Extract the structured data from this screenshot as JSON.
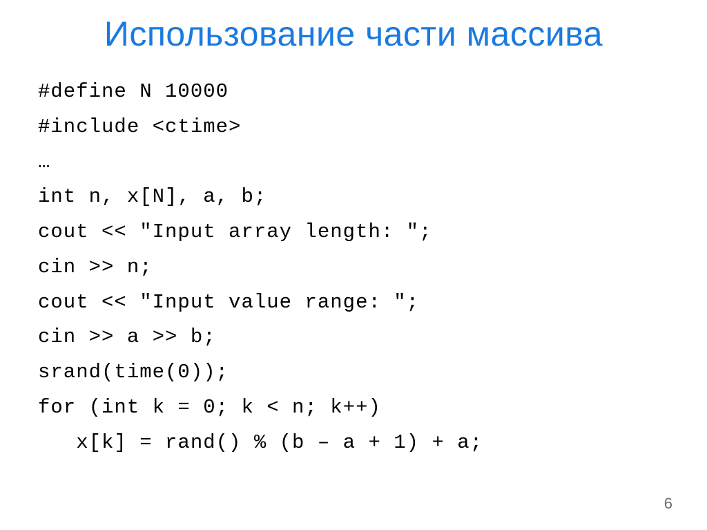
{
  "slide": {
    "title": "Использование части массива",
    "code": {
      "line1": "#define N 10000",
      "line2": "#include <ctime>",
      "line3": "…",
      "line4": "int n, x[N], a, b;",
      "line5": "cout << \"Input array length: \";",
      "line6": "cin >> n;",
      "line7": "cout << \"Input value range: \";",
      "line8": "cin >> a >> b;",
      "line9": "srand(time(0));",
      "line10": "for (int k = 0; k < n; k++)",
      "line11": "   x[k] = rand() % (b – a + 1) + a;"
    },
    "page_number": "6"
  }
}
